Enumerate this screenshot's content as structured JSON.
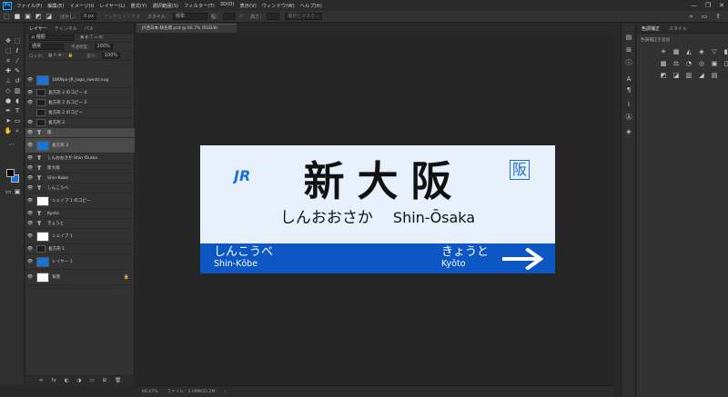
{
  "app": {
    "logo": "Ps",
    "menu": [
      "ファイル(F)",
      "編集(E)",
      "イメージ(I)",
      "レイヤー(L)",
      "書式(Y)",
      "選択範囲(S)",
      "フィルター(T)",
      "3D(D)",
      "表示(V)",
      "ウィンドウ(W)",
      "ヘルプ(H)"
    ],
    "window_controls": [
      "—",
      "❐",
      "✕"
    ]
  },
  "options": {
    "feather_label": "ぼかし：",
    "feather_value": "0 px",
    "antialias": "アンチエイリアス",
    "style_label": "スタイル：",
    "style_value": "標準",
    "width_label": "幅：",
    "height_label": "高さ：",
    "mask_button": "選択とマスク..."
  },
  "layers_panel": {
    "tabs": [
      "レイヤー",
      "チャンネル",
      "パス"
    ],
    "kind_filter": "ρ 種類",
    "blend_mode": "通常",
    "opacity_label": "不透明度：",
    "opacity_value": "100%",
    "lock_label": "ロック：",
    "fill_label": "塗り：",
    "fill_value": "100%",
    "layers": [
      {
        "name": "1869px-JR_logo_(west).svg",
        "type": "image",
        "thumb": "#1a73d6",
        "visible": true,
        "big": true
      },
      {
        "name": "長方形 2 のコピー 4",
        "type": "shape",
        "thumb": "#1e1e1e",
        "visible": true
      },
      {
        "name": "長方形 2 のコピー 2",
        "type": "shape",
        "thumb": "#1e1e1e",
        "visible": true
      },
      {
        "name": "長方形 2 のコピー",
        "type": "shape",
        "thumb": "#1e1e1e",
        "visible": false
      },
      {
        "name": "長方形 2",
        "type": "shape",
        "thumb": "#1e1e1e",
        "visible": true
      },
      {
        "name": "阪",
        "type": "text",
        "visible": true,
        "selected": true
      },
      {
        "name": "長方形 3",
        "type": "shape",
        "thumb": "#1a73d6",
        "visible": true,
        "big": true,
        "selected": true
      },
      {
        "name": "しんおおさか Shin-Ōsaka",
        "type": "text",
        "visible": true
      },
      {
        "name": "新大阪",
        "type": "text",
        "visible": true
      },
      {
        "name": "Shin-Kobe",
        "type": "text",
        "visible": true
      },
      {
        "name": "しんこうべ",
        "type": "text",
        "visible": true
      },
      {
        "name": "シェイプ 1 のコピー",
        "type": "shape",
        "thumb": "#ffffff",
        "visible": true,
        "big": true
      },
      {
        "name": "Kyoto",
        "type": "text",
        "visible": true
      },
      {
        "name": "きょうと",
        "type": "text",
        "visible": true
      },
      {
        "name": "シェイプ 1",
        "type": "shape",
        "thumb": "#ffffff",
        "visible": true,
        "big": true
      },
      {
        "name": "長方形 1",
        "type": "shape",
        "thumb": "#1e1e1e",
        "visible": true
      },
      {
        "name": "レイヤー 1",
        "type": "shape",
        "thumb": "#1a73d6",
        "visible": true,
        "big": true
      },
      {
        "name": "背景",
        "type": "bg",
        "thumb": "#ffffff",
        "visible": true,
        "big": true,
        "locked": true
      }
    ],
    "footer_icons": [
      "∞",
      "fx",
      "◐",
      "◑",
      "▭",
      "⊞",
      "🗑"
    ]
  },
  "document": {
    "tab_title": "JR西日本-駅名標.psd @ 66.7% (RGB/8)",
    "zoom": "66.67%",
    "file_info": "ファイル：2.09M/22.2M"
  },
  "sign": {
    "logo_text": "JR",
    "station_kanji": "新大阪",
    "badge": "阪",
    "reading_kana": "しんおおさか",
    "reading_roman": "Shin-Ōsaka",
    "prev_kana": "しんこうべ",
    "prev_roman": "Shin-Kōbe",
    "next_kana": "きょうと",
    "next_roman": "Kyōto",
    "colors": {
      "background": "#e7f0fb",
      "strip": "#0d57c5",
      "logo": "#1a73d6"
    }
  },
  "right_panel": {
    "tabs": [
      "色調補正",
      "スタイル"
    ],
    "title": "色調補正を追加",
    "icons": [
      "☀",
      "▦",
      "◭",
      "◈",
      "▽",
      "◧",
      "▩",
      "⚖",
      "◔",
      "◎",
      "▣",
      "◫",
      "◩",
      "◪",
      "▥",
      "◢",
      "▤"
    ]
  }
}
